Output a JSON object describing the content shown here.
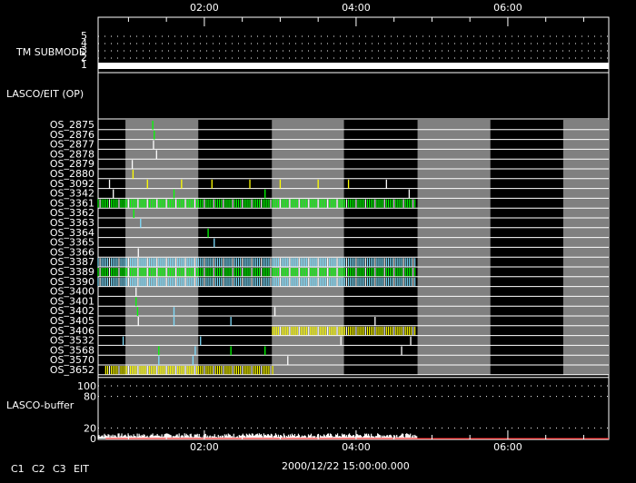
{
  "time_axis": {
    "range_hours": [
      0.6,
      7.33
    ],
    "ticks": [
      {
        "h": 2,
        "label": "02:00"
      },
      {
        "h": 4,
        "label": "04:00"
      },
      {
        "h": 6,
        "label": "06:00"
      }
    ]
  },
  "date_label": "2000/12/22 15:00:00.000",
  "tm_submode": {
    "label": "TM SUBMODE",
    "levels": [
      "1",
      "2",
      "3",
      "4",
      "5"
    ],
    "current_level": 1
  },
  "lasco_eit_label": "LASCO/EIT (OP)",
  "gray_bands": [
    [
      0.96,
      1.92
    ],
    [
      2.89,
      3.84
    ],
    [
      4.81,
      5.77
    ],
    [
      6.73,
      7.33
    ]
  ],
  "rows": [
    {
      "label": "OS_2875",
      "events": [
        [
          1.32,
          "#00ff00"
        ]
      ]
    },
    {
      "label": "OS_2876",
      "events": [
        [
          1.34,
          "#00ff00"
        ]
      ]
    },
    {
      "label": "OS_2877",
      "events": [
        [
          1.33,
          "#ffffff"
        ]
      ]
    },
    {
      "label": "OS_2878",
      "events": [
        [
          1.37,
          "#ffffff"
        ]
      ]
    },
    {
      "label": "OS_2879",
      "events": [
        [
          1.05,
          "#ffffff"
        ]
      ]
    },
    {
      "label": "OS_2880",
      "events": [
        [
          1.06,
          "#ffff00"
        ]
      ]
    },
    {
      "label": "OS_3092",
      "events": [
        [
          0.75,
          "#ffffff"
        ],
        [
          1.25,
          "#ffff00"
        ],
        [
          1.7,
          "#ffff00"
        ],
        [
          2.1,
          "#ffff00"
        ],
        [
          2.6,
          "#ffff00"
        ],
        [
          3.0,
          "#ffff00"
        ],
        [
          3.5,
          "#ffff00"
        ],
        [
          3.9,
          "#ffff00"
        ],
        [
          4.4,
          "#ffffff"
        ]
      ]
    },
    {
      "label": "OS_3342",
      "events": [
        [
          0.8,
          "#ffffff"
        ],
        [
          1.6,
          "#00ff00"
        ],
        [
          2.8,
          "#00ff00"
        ],
        [
          4.7,
          "#ffffff"
        ]
      ]
    },
    {
      "label": "OS_3361",
      "dense": [
        0.6,
        4.8,
        "#00ff00"
      ]
    },
    {
      "label": "OS_3362",
      "events": [
        [
          1.07,
          "#00ff00"
        ]
      ]
    },
    {
      "label": "OS_3363",
      "events": [
        [
          1.16,
          "#7fdfff"
        ]
      ]
    },
    {
      "label": "OS_3364",
      "events": [
        [
          2.05,
          "#00ff00"
        ]
      ]
    },
    {
      "label": "OS_3365",
      "events": [
        [
          2.13,
          "#7fdfff"
        ]
      ]
    },
    {
      "label": "OS_3366",
      "events": [
        [
          1.13,
          "#ffffff"
        ]
      ]
    },
    {
      "label": "OS_3387",
      "dense": [
        0.6,
        4.8,
        "#7fdfff"
      ]
    },
    {
      "label": "OS_3389",
      "dense": [
        0.6,
        4.8,
        "#00ff00"
      ]
    },
    {
      "label": "OS_3390",
      "dense": [
        0.6,
        4.8,
        "#7fdfff"
      ]
    },
    {
      "label": "OS_3400",
      "events": [
        [
          1.1,
          "#ffffff"
        ]
      ]
    },
    {
      "label": "OS_3401",
      "events": [
        [
          1.1,
          "#00ff00"
        ]
      ]
    },
    {
      "label": "OS_3402",
      "events": [
        [
          1.12,
          "#00ff00"
        ],
        [
          1.6,
          "#7fdfff"
        ],
        [
          2.93,
          "#ffffff"
        ]
      ]
    },
    {
      "label": "OS_3405",
      "events": [
        [
          1.13,
          "#ffffff"
        ],
        [
          1.6,
          "#7fdfff"
        ],
        [
          2.35,
          "#7fdfff"
        ],
        [
          4.25,
          "#ffffff"
        ]
      ]
    },
    {
      "label": "OS_3406",
      "dense": [
        2.9,
        4.8,
        "#ffff00"
      ]
    },
    {
      "label": "OS_3532",
      "events": [
        [
          0.93,
          "#7fdfff"
        ],
        [
          1.95,
          "#7fdfff"
        ],
        [
          3.8,
          "#ffffff"
        ],
        [
          4.72,
          "#ffffff"
        ]
      ]
    },
    {
      "label": "OS_3568",
      "events": [
        [
          1.4,
          "#00ff00"
        ],
        [
          1.88,
          "#7fdfff"
        ],
        [
          2.35,
          "#00ff00"
        ],
        [
          2.8,
          "#00ff00"
        ],
        [
          4.6,
          "#ffffff"
        ]
      ]
    },
    {
      "label": "OS_3570",
      "events": [
        [
          1.4,
          "#7fdfff"
        ],
        [
          1.85,
          "#7fdfff"
        ],
        [
          3.1,
          "#ffffff"
        ]
      ]
    },
    {
      "label": "OS_3652",
      "dense": [
        0.7,
        2.9,
        "#ffff00"
      ]
    }
  ],
  "buffer": {
    "label": "LASCO-buffer",
    "ticks": [
      "0",
      "20",
      "80",
      "100"
    ]
  },
  "legend": [
    {
      "label": "C1",
      "color": "#ff0000"
    },
    {
      "label": "C2",
      "color": "#00ff00"
    },
    {
      "label": "C3",
      "color": "#7fdfff"
    },
    {
      "label": "EIT",
      "color": "#ffff00"
    }
  ]
}
